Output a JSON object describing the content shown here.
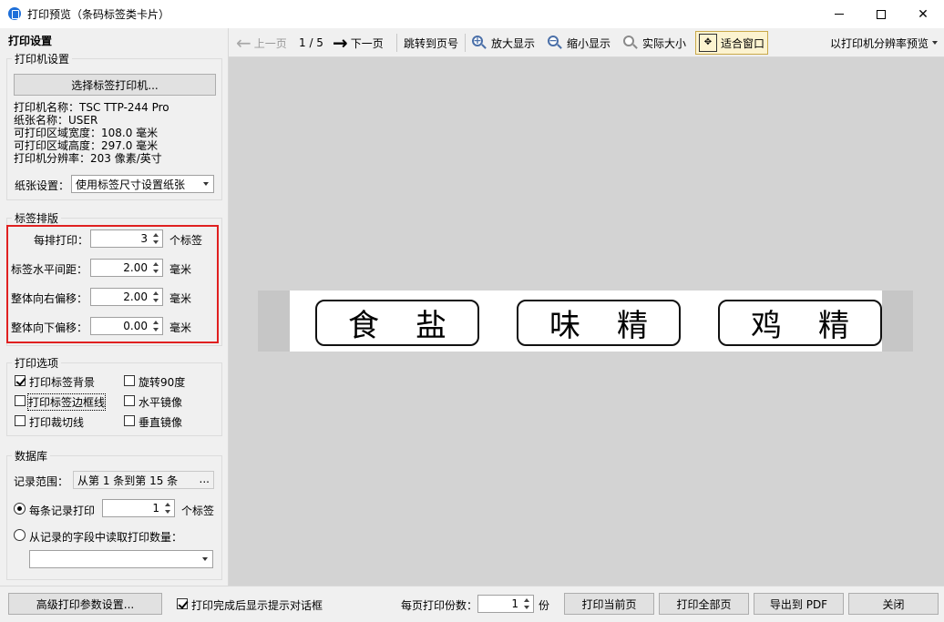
{
  "window": {
    "title": "打印预览（条码标签类卡片）"
  },
  "settings_panel": {
    "title": "打印设置",
    "printer_group": {
      "label": "打印机设置",
      "select_button": "选择标签打印机...",
      "info": [
        "打印机名称：TSC TTP-244 Pro",
        "纸张名称：USER",
        "可打印区域宽度：108.0 毫米",
        "可打印区域高度：297.0 毫米",
        "打印机分辨率：203 像素/英寸"
      ],
      "paper_label": "纸张设置：",
      "paper_value": "使用标签尺寸设置纸张"
    },
    "layout_group": {
      "label": "标签排版",
      "per_row_label": "每排打印：",
      "per_row_value": "3",
      "per_row_unit": "个标签",
      "h_gap_label": "标签水平间距：",
      "h_gap_value": "2.00",
      "h_gap_unit": "毫米",
      "right_offset_label": "整体向右偏移：",
      "right_offset_value": "2.00",
      "right_offset_unit": "毫米",
      "down_offset_label": "整体向下偏移：",
      "down_offset_value": "0.00",
      "down_offset_unit": "毫米"
    },
    "options_group": {
      "label": "打印选项",
      "print_background": "打印标签背景",
      "print_background_checked": true,
      "print_border": "打印标签边框线",
      "print_border_checked": false,
      "print_cutline": "打印裁切线",
      "print_cutline_checked": false,
      "rotate90": "旋转90度",
      "rotate90_checked": false,
      "mirror_h": "水平镜像",
      "mirror_h_checked": false,
      "mirror_v": "垂直镜像",
      "mirror_v_checked": false
    },
    "database_group": {
      "label": "数据库",
      "range_label": "记录范围：",
      "range_value": "从第 1 条到第 15 条",
      "range_button": "...",
      "per_record_label": "每条记录打印",
      "per_record_value": "1",
      "per_record_unit": "个标签",
      "per_record_checked": true,
      "from_field_label": "从记录的字段中读取打印数量：",
      "from_field_checked": false,
      "field_value": ""
    }
  },
  "toolbar": {
    "prev": "上一页",
    "page": "1 / 5",
    "next": "下一页",
    "goto": "跳转到页号",
    "zoom_in": "放大显示",
    "zoom_out": "缩小显示",
    "actual_size": "实际大小",
    "fit_window": "适合窗口",
    "resolution_preview": "以打印机分辨率预览"
  },
  "preview": {
    "labels": [
      {
        "a": "食",
        "b": "盐"
      },
      {
        "a": "味",
        "b": "精"
      },
      {
        "a": "鸡",
        "b": "精"
      }
    ]
  },
  "bottom": {
    "advanced_button": "高级打印参数设置...",
    "show_dialog_label": "打印完成后显示提示对话框",
    "show_dialog_checked": true,
    "copies_label": "每页打印份数：",
    "copies_value": "1",
    "copies_unit": "份",
    "print_current": "打印当前页",
    "print_all": "打印全部页",
    "export_pdf": "导出到 PDF",
    "close": "关闭"
  }
}
